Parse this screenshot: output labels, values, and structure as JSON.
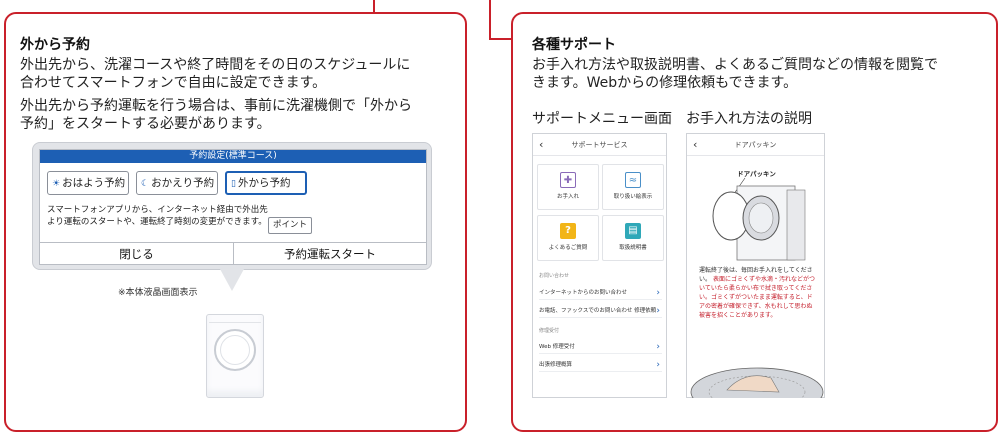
{
  "left": {
    "title": "外から予約",
    "para1_line1": "外出先から、洗濯コースや終了時間をその日のスケジュールに",
    "para1_line2": "合わせてスマートフォンで自由に設定できます。",
    "para2_line1": "外出先から予約運転を行う場合は、事前に洗濯機側で「外から",
    "para2_line2": "予約」をスタートする必要があります。",
    "lcd": {
      "header": "予約設定(標準コース)",
      "modes": [
        {
          "label": "おはよう予約",
          "icon": "sun-icon",
          "selected": false
        },
        {
          "label": "おかえり予約",
          "icon": "moon-icon",
          "selected": false
        },
        {
          "label": "外から予約",
          "icon": "phone-icon",
          "selected": true
        }
      ],
      "note_line1": "スマートフォンアプリから、インターネット経由で外出先",
      "note_line2": "より運転のスタートや、運転終了時刻の変更ができます。",
      "point_label": "ポイント",
      "close_label": "閉じる",
      "start_label": "予約運転スタート"
    },
    "caption": "※本体液晶画面表示"
  },
  "right": {
    "title": "各種サポート",
    "para_line1": "お手入れ方法や取扱説明書、よくあるご質問などの情報を閲覧で",
    "para_line2": "きます。Webからの修理依頼もできます。",
    "label_support_menu": "サポートメニュー画面",
    "label_care": "お手入れ方法の説明",
    "support_phone": {
      "title": "サポートサービス",
      "tiles": [
        {
          "label": "お手入れ",
          "icon": "spray-icon",
          "color": "#8a6bb8"
        },
        {
          "label": "取り扱い絵表示",
          "icon": "washtub-icon",
          "color": "#4a8fc8"
        },
        {
          "label": "よくあるご質問",
          "icon": "question-icon",
          "color": "#f2b517"
        },
        {
          "label": "取扱説明書",
          "icon": "manual-icon",
          "color": "#2fa8b8"
        }
      ],
      "section1": "お問い合わせ",
      "rows1": [
        "インターネットからのお問い合わせ",
        "お電話、ファックスでのお問い合わせ 修理依頼"
      ],
      "section2": "修理受付",
      "rows2": [
        "Web 修理受付",
        "出張修理概算"
      ]
    },
    "care_phone": {
      "title": "ドアパッキン",
      "diagram_label": "ドアパッキン",
      "text_normal": "運転終了後は、毎回お手入れをしてください。",
      "text_warn": "表面にゴミくずや水滴・汚れなどがついていたら柔らかい布で拭き取ってください。ゴミくずがついたまま運転すると、ドアの密着が確保できず、水もれして思わぬ被害を招くことがあります。"
    }
  },
  "colors": {
    "frame": "#c9202a",
    "lcd_header": "#1d5fb4"
  }
}
